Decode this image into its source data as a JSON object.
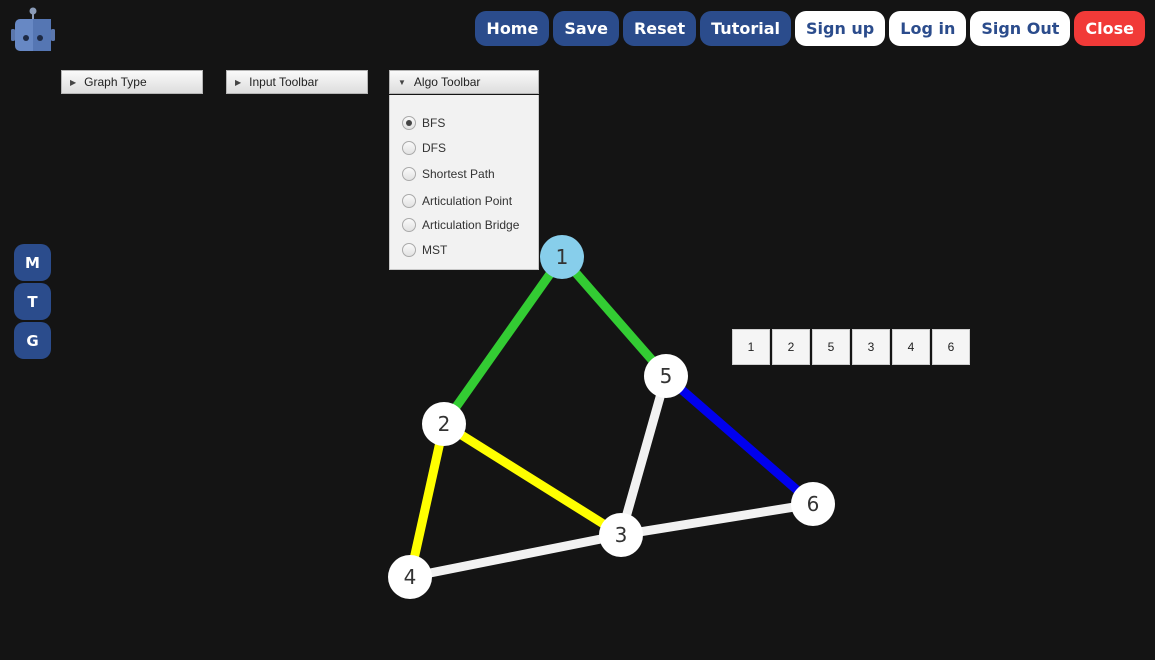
{
  "logo": {
    "icon": "robot-icon"
  },
  "topbar": {
    "home": "Home",
    "save": "Save",
    "reset": "Reset",
    "tutorial": "Tutorial",
    "signup": "Sign up",
    "login": "Log in",
    "signout": "Sign Out",
    "close": "Close"
  },
  "sidebar": {
    "m": "M",
    "t": "T",
    "g": "G"
  },
  "panels": {
    "graph_type": "Graph Type",
    "input_toolbar": "Input Toolbar",
    "algo_toolbar": "Algo Toolbar"
  },
  "algo": {
    "selected": "BFS",
    "options": [
      "BFS",
      "DFS",
      "Shortest Path",
      "Articulation Point",
      "Articulation Bridge",
      "MST"
    ]
  },
  "traversal_order": [
    "1",
    "2",
    "5",
    "3",
    "4",
    "6"
  ],
  "graph": {
    "nodes": [
      {
        "id": "1",
        "label": "1",
        "color": "#87ceeb"
      },
      {
        "id": "2",
        "label": "2",
        "color": "#ffffff"
      },
      {
        "id": "3",
        "label": "3",
        "color": "#ffffff"
      },
      {
        "id": "4",
        "label": "4",
        "color": "#ffffff"
      },
      {
        "id": "5",
        "label": "5",
        "color": "#ffffff"
      },
      {
        "id": "6",
        "label": "6",
        "color": "#ffffff"
      }
    ],
    "edges": [
      {
        "from": "1",
        "to": "2",
        "color": "#33cc33"
      },
      {
        "from": "1",
        "to": "5",
        "color": "#33cc33"
      },
      {
        "from": "2",
        "to": "3",
        "color": "#ffff00"
      },
      {
        "from": "2",
        "to": "4",
        "color": "#ffff00"
      },
      {
        "from": "5",
        "to": "3",
        "color": "#f2f2f2"
      },
      {
        "from": "5",
        "to": "6",
        "color": "#0000ee"
      },
      {
        "from": "3",
        "to": "4",
        "color": "#f2f2f2"
      },
      {
        "from": "3",
        "to": "6",
        "color": "#f2f2f2"
      }
    ]
  },
  "colors": {
    "accent": "#2b4c8c",
    "close": "#f13a38",
    "background": "#141414"
  }
}
